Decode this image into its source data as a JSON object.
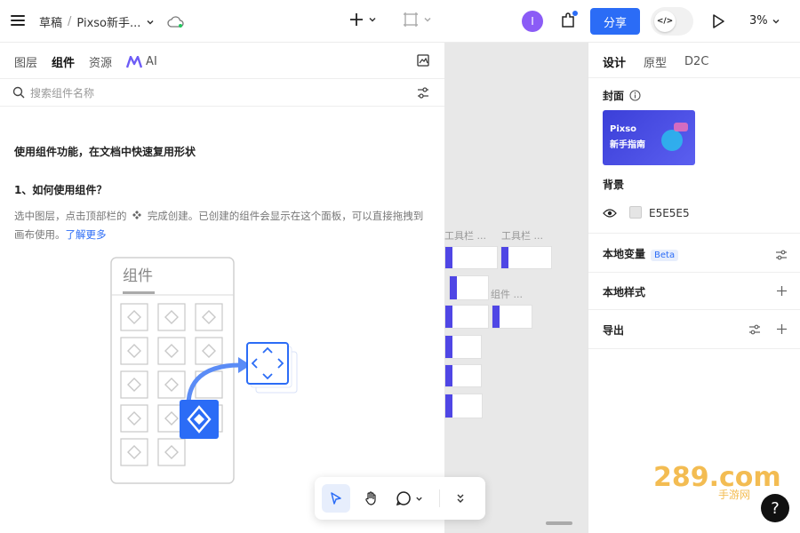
{
  "header": {
    "breadcrumb_root": "草稿",
    "breadcrumb_sep": "/",
    "file_name": "Pixso新手...",
    "avatar_letter": "I",
    "share_label": "分享",
    "zoom": "3%"
  },
  "left_panel": {
    "tabs": [
      "图层",
      "组件",
      "资源",
      "AI"
    ],
    "active_tab": "组件",
    "search_placeholder": "搜索组件名称",
    "heading": "使用组件功能，在文档中快速复用形状",
    "subheading": "1、如何使用组件？",
    "desc_part1": "选中图层，点击顶部栏的",
    "desc_part2": "完成创建。已创建的组件会显示在这个面板，可以直接拖拽到画布使用。",
    "learn_more": "了解更多",
    "illustration_label": "组件"
  },
  "canvas": {
    "labels": [
      "工具栏 ...",
      "工具栏 ...",
      "组件 ..."
    ]
  },
  "right_panel": {
    "tabs": [
      "设计",
      "原型",
      "D2C"
    ],
    "active_tab": "设计",
    "cover_title": "封面",
    "cover_text_1": "Pixso",
    "cover_text_2": "新手指南",
    "background_title": "背景",
    "bg_hex": "E5E5E5",
    "local_variables": "本地变量",
    "beta": "Beta",
    "local_styles": "本地样式",
    "export": "导出"
  },
  "watermark": {
    "text": "289.com",
    "sub": "手游网"
  },
  "colors": {
    "accent": "#2b6cf6",
    "avatar": "#8b5cf6",
    "canvas_bg": "#e8e8e8",
    "illustration_blue": "#2b6cf6"
  }
}
